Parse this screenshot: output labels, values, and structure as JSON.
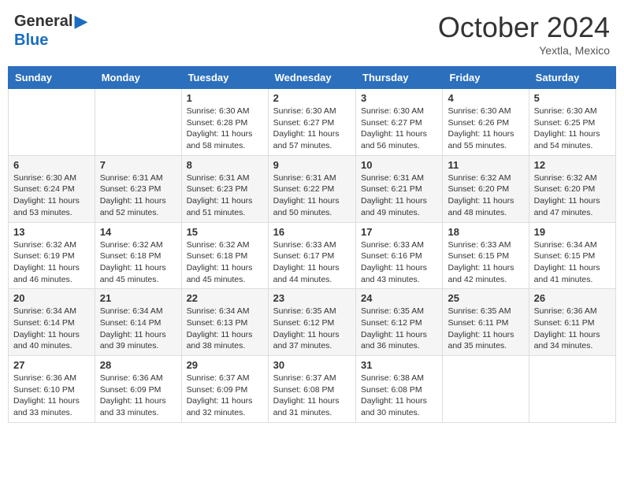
{
  "logo": {
    "general": "General",
    "blue": "Blue"
  },
  "title": "October 2024",
  "subtitle": "Yextla, Mexico",
  "days_of_week": [
    "Sunday",
    "Monday",
    "Tuesday",
    "Wednesday",
    "Thursday",
    "Friday",
    "Saturday"
  ],
  "weeks": [
    [
      {
        "day": "",
        "info": ""
      },
      {
        "day": "",
        "info": ""
      },
      {
        "day": "1",
        "info": "Sunrise: 6:30 AM\nSunset: 6:28 PM\nDaylight: 11 hours and 58 minutes."
      },
      {
        "day": "2",
        "info": "Sunrise: 6:30 AM\nSunset: 6:27 PM\nDaylight: 11 hours and 57 minutes."
      },
      {
        "day": "3",
        "info": "Sunrise: 6:30 AM\nSunset: 6:27 PM\nDaylight: 11 hours and 56 minutes."
      },
      {
        "day": "4",
        "info": "Sunrise: 6:30 AM\nSunset: 6:26 PM\nDaylight: 11 hours and 55 minutes."
      },
      {
        "day": "5",
        "info": "Sunrise: 6:30 AM\nSunset: 6:25 PM\nDaylight: 11 hours and 54 minutes."
      }
    ],
    [
      {
        "day": "6",
        "info": "Sunrise: 6:30 AM\nSunset: 6:24 PM\nDaylight: 11 hours and 53 minutes."
      },
      {
        "day": "7",
        "info": "Sunrise: 6:31 AM\nSunset: 6:23 PM\nDaylight: 11 hours and 52 minutes."
      },
      {
        "day": "8",
        "info": "Sunrise: 6:31 AM\nSunset: 6:23 PM\nDaylight: 11 hours and 51 minutes."
      },
      {
        "day": "9",
        "info": "Sunrise: 6:31 AM\nSunset: 6:22 PM\nDaylight: 11 hours and 50 minutes."
      },
      {
        "day": "10",
        "info": "Sunrise: 6:31 AM\nSunset: 6:21 PM\nDaylight: 11 hours and 49 minutes."
      },
      {
        "day": "11",
        "info": "Sunrise: 6:32 AM\nSunset: 6:20 PM\nDaylight: 11 hours and 48 minutes."
      },
      {
        "day": "12",
        "info": "Sunrise: 6:32 AM\nSunset: 6:20 PM\nDaylight: 11 hours and 47 minutes."
      }
    ],
    [
      {
        "day": "13",
        "info": "Sunrise: 6:32 AM\nSunset: 6:19 PM\nDaylight: 11 hours and 46 minutes."
      },
      {
        "day": "14",
        "info": "Sunrise: 6:32 AM\nSunset: 6:18 PM\nDaylight: 11 hours and 45 minutes."
      },
      {
        "day": "15",
        "info": "Sunrise: 6:32 AM\nSunset: 6:18 PM\nDaylight: 11 hours and 45 minutes."
      },
      {
        "day": "16",
        "info": "Sunrise: 6:33 AM\nSunset: 6:17 PM\nDaylight: 11 hours and 44 minutes."
      },
      {
        "day": "17",
        "info": "Sunrise: 6:33 AM\nSunset: 6:16 PM\nDaylight: 11 hours and 43 minutes."
      },
      {
        "day": "18",
        "info": "Sunrise: 6:33 AM\nSunset: 6:15 PM\nDaylight: 11 hours and 42 minutes."
      },
      {
        "day": "19",
        "info": "Sunrise: 6:34 AM\nSunset: 6:15 PM\nDaylight: 11 hours and 41 minutes."
      }
    ],
    [
      {
        "day": "20",
        "info": "Sunrise: 6:34 AM\nSunset: 6:14 PM\nDaylight: 11 hours and 40 minutes."
      },
      {
        "day": "21",
        "info": "Sunrise: 6:34 AM\nSunset: 6:14 PM\nDaylight: 11 hours and 39 minutes."
      },
      {
        "day": "22",
        "info": "Sunrise: 6:34 AM\nSunset: 6:13 PM\nDaylight: 11 hours and 38 minutes."
      },
      {
        "day": "23",
        "info": "Sunrise: 6:35 AM\nSunset: 6:12 PM\nDaylight: 11 hours and 37 minutes."
      },
      {
        "day": "24",
        "info": "Sunrise: 6:35 AM\nSunset: 6:12 PM\nDaylight: 11 hours and 36 minutes."
      },
      {
        "day": "25",
        "info": "Sunrise: 6:35 AM\nSunset: 6:11 PM\nDaylight: 11 hours and 35 minutes."
      },
      {
        "day": "26",
        "info": "Sunrise: 6:36 AM\nSunset: 6:11 PM\nDaylight: 11 hours and 34 minutes."
      }
    ],
    [
      {
        "day": "27",
        "info": "Sunrise: 6:36 AM\nSunset: 6:10 PM\nDaylight: 11 hours and 33 minutes."
      },
      {
        "day": "28",
        "info": "Sunrise: 6:36 AM\nSunset: 6:09 PM\nDaylight: 11 hours and 33 minutes."
      },
      {
        "day": "29",
        "info": "Sunrise: 6:37 AM\nSunset: 6:09 PM\nDaylight: 11 hours and 32 minutes."
      },
      {
        "day": "30",
        "info": "Sunrise: 6:37 AM\nSunset: 6:08 PM\nDaylight: 11 hours and 31 minutes."
      },
      {
        "day": "31",
        "info": "Sunrise: 6:38 AM\nSunset: 6:08 PM\nDaylight: 11 hours and 30 minutes."
      },
      {
        "day": "",
        "info": ""
      },
      {
        "day": "",
        "info": ""
      }
    ]
  ]
}
